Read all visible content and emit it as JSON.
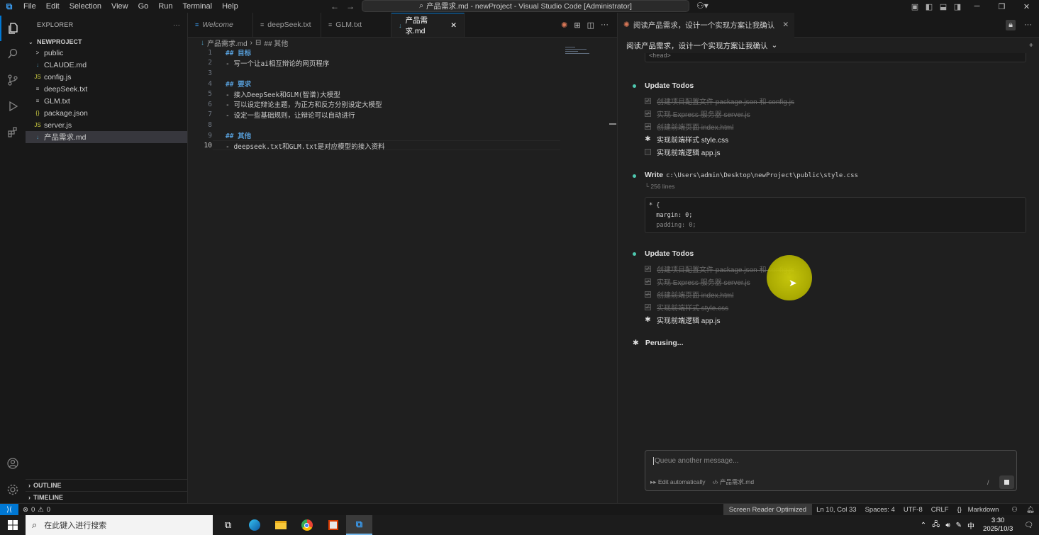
{
  "titlebar": {
    "menu": [
      "File",
      "Edit",
      "Selection",
      "View",
      "Go",
      "Run",
      "Terminal",
      "Help"
    ],
    "title": "产品需求.md - newProject - Visual Studio Code [Administrator]"
  },
  "sidebar": {
    "header": "EXPLORER",
    "project": "NEWPROJECT",
    "items": [
      {
        "label": "public",
        "icon": "chevron-right-icon",
        "badge": ">",
        "color": "#cccccc"
      },
      {
        "label": "CLAUDE.md",
        "icon": "markdown-icon",
        "badge": "↓",
        "color": "#519aba"
      },
      {
        "label": "config.js",
        "icon": "js-icon",
        "badge": "JS",
        "color": "#cbcb41"
      },
      {
        "label": "deepSeek.txt",
        "icon": "text-file-icon",
        "badge": "≡",
        "color": "#cccccc"
      },
      {
        "label": "GLM.txt",
        "icon": "text-file-icon",
        "badge": "≡",
        "color": "#cccccc"
      },
      {
        "label": "package.json",
        "icon": "json-icon",
        "badge": "{}",
        "color": "#cbcb41"
      },
      {
        "label": "server.js",
        "icon": "js-icon",
        "badge": "JS",
        "color": "#cbcb41"
      },
      {
        "label": "产品需求.md",
        "icon": "markdown-icon",
        "badge": "↓",
        "color": "#519aba"
      }
    ],
    "outline": "OUTLINE",
    "timeline": "TIMELINE"
  },
  "editor": {
    "tabs": [
      {
        "label": "Welcome",
        "icon": "≡"
      },
      {
        "label": "deepSeek.txt",
        "icon": "≡"
      },
      {
        "label": "GLM.txt",
        "icon": "≡"
      },
      {
        "label": "产品需求.md",
        "icon": "↓"
      }
    ],
    "breadcrumb": {
      "file": "产品需求.md",
      "section": "## 其他"
    },
    "lines": [
      {
        "n": "1",
        "text": "## 目标",
        "heading": true
      },
      {
        "n": "2",
        "text": "- 写一个让ai相互辩论的网页程序",
        "heading": false
      },
      {
        "n": "3",
        "text": "",
        "heading": false
      },
      {
        "n": "4",
        "text": "## 要求",
        "heading": true
      },
      {
        "n": "5",
        "text": "- 接入DeepSeek和GLM(智谱)大模型",
        "heading": false
      },
      {
        "n": "6",
        "text": "- 可以设定辩论主题，为正方和反方分别设定大模型",
        "heading": false
      },
      {
        "n": "7",
        "text": "- 设定一些基础规则，让辩论可以自动进行",
        "heading": false
      },
      {
        "n": "8",
        "text": "",
        "heading": false
      },
      {
        "n": "9",
        "text": "## 其他",
        "heading": true
      },
      {
        "n": "10",
        "text": "- deepseek.txt和GLM.txt是对应模型的接入资料",
        "heading": false
      }
    ]
  },
  "chat": {
    "tab_label": "阅读产品需求，设计一个实现方案让我确认",
    "header": "阅读产品需求，设计一个实现方案让我确认",
    "top_code": "<head>",
    "todos1_title": "Update Todos",
    "todos1": [
      {
        "label": "创建项目配置文件 package.json 和 config.js",
        "state": "done"
      },
      {
        "label": "实现 Express 服务器 server.js",
        "state": "done"
      },
      {
        "label": "创建前端页面 index.html",
        "state": "done"
      },
      {
        "label": "实现前端样式 style.css",
        "state": "active"
      },
      {
        "label": "实现前端逻辑 app.js",
        "state": "pending"
      }
    ],
    "write_title": "Write",
    "write_path": "c:\\Users\\admin\\Desktop\\newProject\\public\\style.css",
    "write_lines": "└ 256 lines",
    "code": [
      "* {",
      "  margin: 0;",
      "  padding: 0;"
    ],
    "todos2_title": "Update Todos",
    "todos2": [
      {
        "label": "创建项目配置文件 package.json 和 config.js",
        "state": "done"
      },
      {
        "label": "实现 Express 服务器 server.js",
        "state": "done"
      },
      {
        "label": "创建前端页面 index.html",
        "state": "done"
      },
      {
        "label": "实现前端样式 style.css",
        "state": "done"
      },
      {
        "label": "实现前端逻辑 app.js",
        "state": "active"
      }
    ],
    "status": "Perusing...",
    "input_placeholder": "Queue another message...",
    "edit_mode": "Edit automatically",
    "context_file": "产品需求.md",
    "slash": "/"
  },
  "statusbar": {
    "errors": "0",
    "warnings": "0",
    "screen_reader": "Screen Reader Optimized",
    "position": "Ln 10, Col 33",
    "spaces": "Spaces: 4",
    "encoding": "UTF-8",
    "eol": "CRLF",
    "language": "Markdown"
  },
  "taskbar": {
    "search_placeholder": "在此键入进行搜索",
    "ime": "中",
    "time": "3:30",
    "date": "2025/10/3"
  },
  "colors": {
    "accent": "#0078d4",
    "todo_bullet": "#4ec9b0",
    "cursor_highlight": "#c8c800"
  }
}
